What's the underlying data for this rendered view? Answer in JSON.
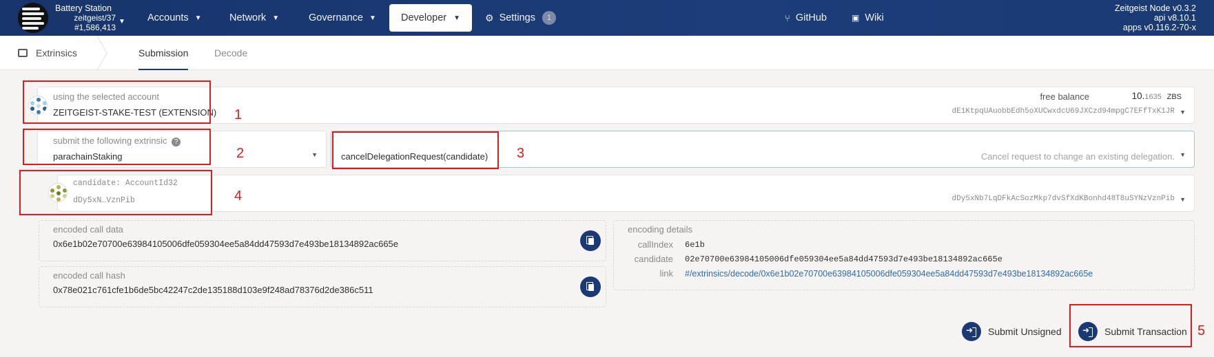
{
  "header": {
    "chain_name": "Battery Station",
    "chain_sub": "zeitgeist/37",
    "block": "#1,586,413",
    "nav": [
      {
        "label": "Accounts"
      },
      {
        "label": "Network"
      },
      {
        "label": "Governance"
      },
      {
        "label": "Developer"
      },
      {
        "label": "Settings",
        "badge": "1"
      },
      {
        "label": "GitHub"
      },
      {
        "label": "Wiki"
      }
    ],
    "node": [
      "Zeitgeist Node v0.3.2",
      "api v8.10.1",
      "apps v0.116.2-70-x"
    ]
  },
  "subnav": {
    "section": "Extrinsics",
    "tabs": [
      "Submission",
      "Decode"
    ]
  },
  "account": {
    "label": "using the selected account",
    "name": "ZEITGEIST-STAKE-TEST (EXTENSION)",
    "balance_label": "free balance",
    "balance_int": "10.",
    "balance_frac": "1635",
    "balance_unit": "ZBS",
    "address": "dE1KtpqUAuobbEdh5oXUCwxdcU69JXCzd94mpgC7EFfTxK1JR"
  },
  "extrinsic": {
    "label": "submit the following extrinsic",
    "help": "?",
    "module": "parachainStaking",
    "call": "cancelDelegationRequest(candidate)",
    "description": "Cancel request to change an existing delegation."
  },
  "param": {
    "label": "candidate: AccountId32",
    "short": "dDy5xN…VznPib",
    "address": "dDy5xNb7LqDFkAcSozMkp7dvSfXdKBonhd48T8uSYNzVznPib"
  },
  "encoded": {
    "call_data_label": "encoded call data",
    "call_data": "0x6e1b02e70700e63984105006dfe059304ee5a84dd47593d7e493be18134892ac665e",
    "call_hash_label": "encoded call hash",
    "call_hash": "0x78e021c761cfe1b6de5bc42247c2de135188d103e9f248ad78376d2de386c511"
  },
  "details": {
    "label": "encoding details",
    "rows": [
      {
        "k": "callIndex",
        "v": "6e1b"
      },
      {
        "k": "candidate",
        "v": "02e70700e63984105006dfe059304ee5a84dd47593d7e493be18134892ac665e"
      },
      {
        "k": "link",
        "v": "#/extrinsics/decode/0x6e1b02e70700e63984105006dfe059304ee5a84dd47593d7e493be18134892ac665e"
      }
    ]
  },
  "actions": {
    "unsigned": "Submit Unsigned",
    "submit": "Submit Transaction"
  },
  "annotations": [
    "1",
    "2",
    "3",
    "4",
    "5"
  ],
  "colors": {
    "header": "#1c3d7a",
    "accent": "#1b3a75",
    "annotation": "#e11b1b"
  }
}
